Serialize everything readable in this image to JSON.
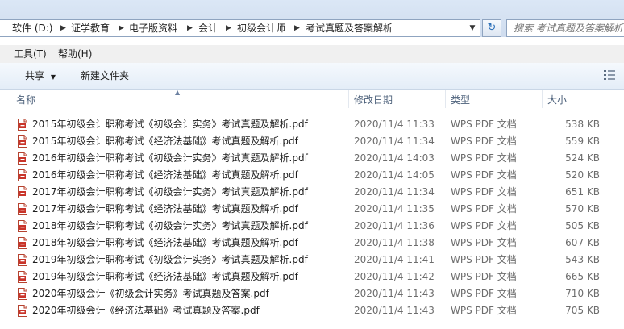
{
  "address": {
    "crumbs": [
      "软件 (D:)",
      "证学教育",
      "电子版资料",
      "会计",
      "初级会计师",
      "考试真题及答案解析"
    ],
    "search_placeholder": "搜索 考试真题及答案解析"
  },
  "menu": {
    "tools": "工具(T)",
    "help": "帮助(H)"
  },
  "toolbar": {
    "share": "共享",
    "new_folder": "新建文件夹"
  },
  "columns": {
    "name": "名称",
    "date": "修改日期",
    "type": "类型",
    "size": "大小"
  },
  "files": [
    {
      "name": "2015年初级会计职称考试《初级会计实务》考试真题及解析.pdf",
      "date": "2020/11/4 11:33",
      "type": "WPS PDF 文档",
      "size": "538 KB"
    },
    {
      "name": "2015年初级会计职称考试《经济法基础》考试真题及解析.pdf",
      "date": "2020/11/4 11:34",
      "type": "WPS PDF 文档",
      "size": "559 KB"
    },
    {
      "name": "2016年初级会计职称考试《初级会计实务》考试真题及解析.pdf",
      "date": "2020/11/4 14:03",
      "type": "WPS PDF 文档",
      "size": "524 KB"
    },
    {
      "name": "2016年初级会计职称考试《经济法基础》考试真题及解析.pdf",
      "date": "2020/11/4 14:05",
      "type": "WPS PDF 文档",
      "size": "520 KB"
    },
    {
      "name": "2017年初级会计职称考试《初级会计实务》考试真题及解析.pdf",
      "date": "2020/11/4 11:34",
      "type": "WPS PDF 文档",
      "size": "651 KB"
    },
    {
      "name": "2017年初级会计职称考试《经济法基础》考试真题及解析.pdf",
      "date": "2020/11/4 11:35",
      "type": "WPS PDF 文档",
      "size": "570 KB"
    },
    {
      "name": "2018年初级会计职称考试《初级会计实务》考试真题及解析.pdf",
      "date": "2020/11/4 11:36",
      "type": "WPS PDF 文档",
      "size": "505 KB"
    },
    {
      "name": "2018年初级会计职称考试《经济法基础》考试真题及解析.pdf",
      "date": "2020/11/4 11:38",
      "type": "WPS PDF 文档",
      "size": "607 KB"
    },
    {
      "name": "2019年初级会计职称考试《初级会计实务》考试真题及解析.pdf",
      "date": "2020/11/4 11:41",
      "type": "WPS PDF 文档",
      "size": "543 KB"
    },
    {
      "name": "2019年初级会计职称考试《经济法基础》考试真题及解析.pdf",
      "date": "2020/11/4 11:42",
      "type": "WPS PDF 文档",
      "size": "665 KB"
    },
    {
      "name": "2020年初级会计《初级会计实务》考试真题及答案.pdf",
      "date": "2020/11/4 11:43",
      "type": "WPS PDF 文档",
      "size": "710 KB"
    },
    {
      "name": "2020年初级会计《经济法基础》考试真题及答案.pdf",
      "date": "2020/11/4 11:43",
      "type": "WPS PDF 文档",
      "size": "705 KB"
    }
  ]
}
